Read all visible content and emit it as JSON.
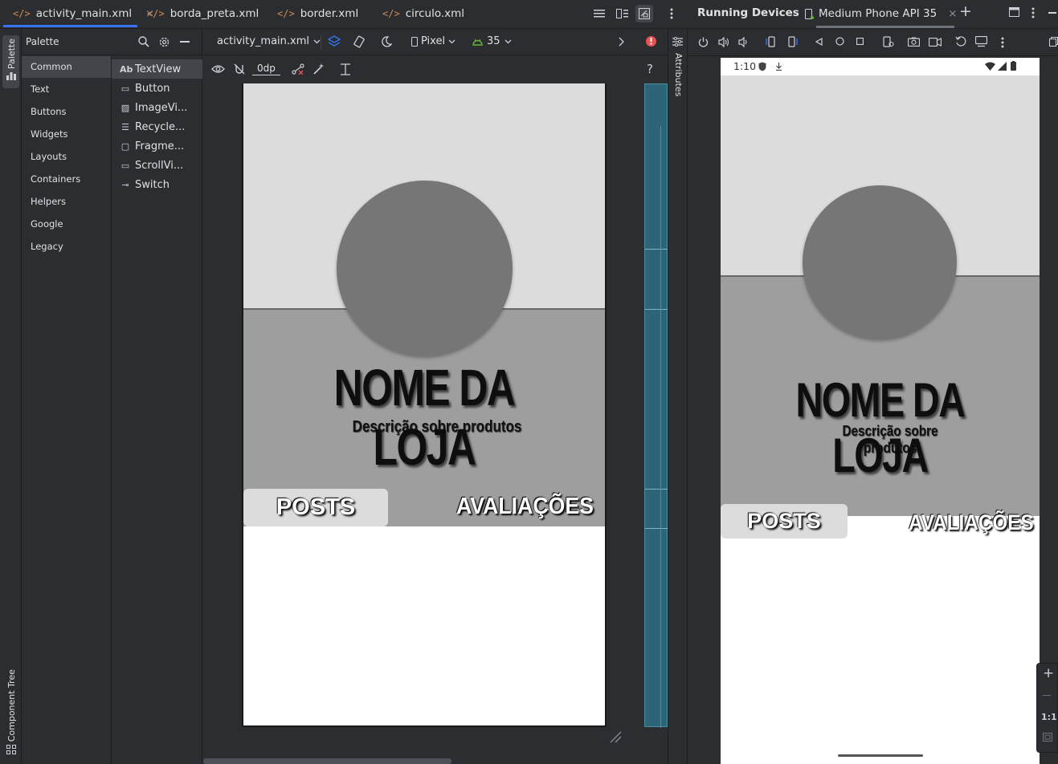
{
  "tabs": [
    {
      "label": "activity_main.xml",
      "active": true
    },
    {
      "label": "borda_preta.xml",
      "active": false
    },
    {
      "label": "border.xml",
      "active": false
    },
    {
      "label": "circulo.xml",
      "active": false
    }
  ],
  "tab_icon": "</>",
  "close_glyph": "×",
  "side_labels": {
    "palette": "Palette",
    "component_tree": "Component Tree",
    "attributes": "Attributes"
  },
  "palette": {
    "title": "Palette",
    "categories": [
      "Common",
      "Text",
      "Buttons",
      "Widgets",
      "Layouts",
      "Containers",
      "Helpers",
      "Google",
      "Legacy"
    ],
    "selected_category": "Common",
    "widgets": [
      {
        "label": "TextView",
        "icon": "Ab"
      },
      {
        "label": "Button",
        "icon": "▭"
      },
      {
        "label": "ImageVi...",
        "icon": "▨"
      },
      {
        "label": "Recycle...",
        "icon": "☰"
      },
      {
        "label": "Fragme...",
        "icon": "▢"
      },
      {
        "label": "ScrollVi...",
        "icon": "▭"
      },
      {
        "label": "Switch",
        "icon": "⊸"
      }
    ]
  },
  "design_toolbar": {
    "file": "activity_main.xml",
    "device": "Pixel",
    "api": "35",
    "margin": "0dp",
    "help": "?"
  },
  "preview": {
    "title": "NOME DA LOJA",
    "subtitle": "Descrição sobre produtos",
    "tab_posts": "POSTS",
    "tab_reviews": "AVALIAÇÕES"
  },
  "running_devices": {
    "title": "Running Devices",
    "device_tab": "Medium Phone API 35",
    "add": "+",
    "status_time": "1:10",
    "zoom_label": "1:1",
    "zoom_in": "+",
    "zoom_out": "—"
  },
  "colors": {
    "accent": "#3574f0",
    "error": "#e55353",
    "android_green": "#5fb832",
    "preview_light": "#dcdcdc",
    "preview_mid": "#9e9e9e",
    "preview_circle": "#767676"
  }
}
